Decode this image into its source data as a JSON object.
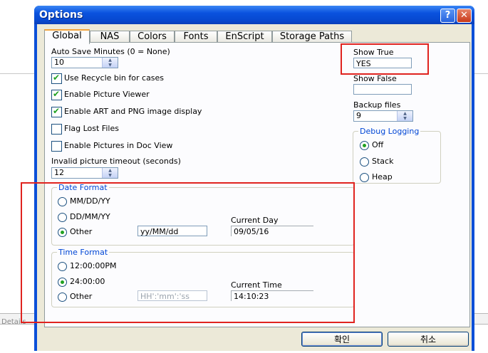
{
  "background": {
    "status_label": "Details"
  },
  "window": {
    "title": "Options",
    "help_glyph": "?",
    "close_glyph": "✕"
  },
  "tabs": [
    "Global",
    "NAS",
    "Colors",
    "Fonts",
    "EnScript",
    "Storage Paths"
  ],
  "global": {
    "auto_save_label": "Auto Save Minutes (0 = None)",
    "auto_save_value": "10",
    "use_recycle_bin": {
      "label": "Use Recycle bin for cases",
      "checked": true
    },
    "enable_picture_viewer": {
      "label": "Enable Picture Viewer",
      "checked": true
    },
    "enable_art_png": {
      "label": "Enable ART and PNG image display",
      "checked": true
    },
    "flag_lost_files": {
      "label": "Flag Lost Files",
      "checked": false
    },
    "enable_pictures_doc_view": {
      "label": "Enable Pictures in Doc View",
      "checked": false
    },
    "invalid_timeout_label": "Invalid picture timeout (seconds)",
    "invalid_timeout_value": "12",
    "show_true_label": "Show True",
    "show_true_value": "YES",
    "show_false_label": "Show False",
    "show_false_value": "",
    "backup_files_label": "Backup files",
    "backup_files_value": "9",
    "debug_logging": {
      "legend": "Debug Logging",
      "options": [
        "Off",
        "Stack",
        "Heap"
      ],
      "selected": "Off"
    },
    "date_format": {
      "legend": "Date Format",
      "options": [
        "MM/DD/YY",
        "DD/MM/YY",
        "Other"
      ],
      "selected": "Other",
      "other_value": "yy/MM/dd",
      "current_label": "Current Day",
      "current_value": "09/05/16"
    },
    "time_format": {
      "legend": "Time Format",
      "options": [
        "12:00:00PM",
        "24:00:00",
        "Other"
      ],
      "selected": "24:00:00",
      "other_placeholder": "HH':'mm':'ss",
      "current_label": "Current Time",
      "current_value": "14:10:23"
    }
  },
  "buttons": {
    "ok": "확인",
    "cancel": "취소"
  },
  "colors": {
    "highlight_box": "#e0231f",
    "title_bar": "#0a52de",
    "group_legend": "#0046d5"
  }
}
